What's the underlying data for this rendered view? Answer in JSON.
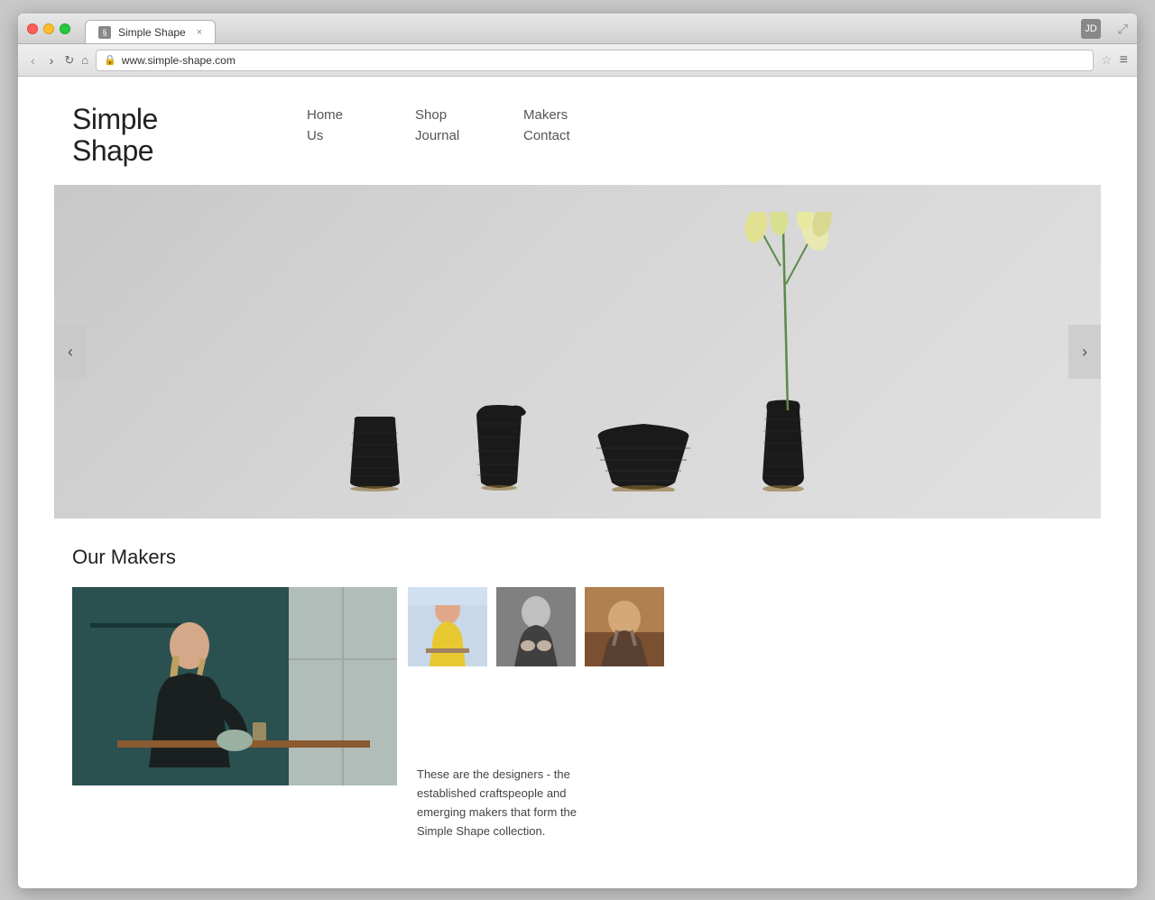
{
  "browser": {
    "tab_title": "Simple Shape",
    "url": "www.simple-shape.com",
    "user_initials": "JD"
  },
  "site": {
    "logo_line1": "Simple",
    "logo_line2": "Shape",
    "nav": {
      "col1": [
        "Home",
        "Us"
      ],
      "col2": [
        "Shop",
        "Journal"
      ],
      "col3": [
        "Makers",
        "Contact"
      ]
    },
    "slider": {
      "arrow_left": "‹",
      "arrow_right": "›"
    },
    "makers": {
      "title": "Our Makers",
      "description": "These are the designers - the established craftspeople and emerging makers that form the Simple Shape collection."
    }
  }
}
